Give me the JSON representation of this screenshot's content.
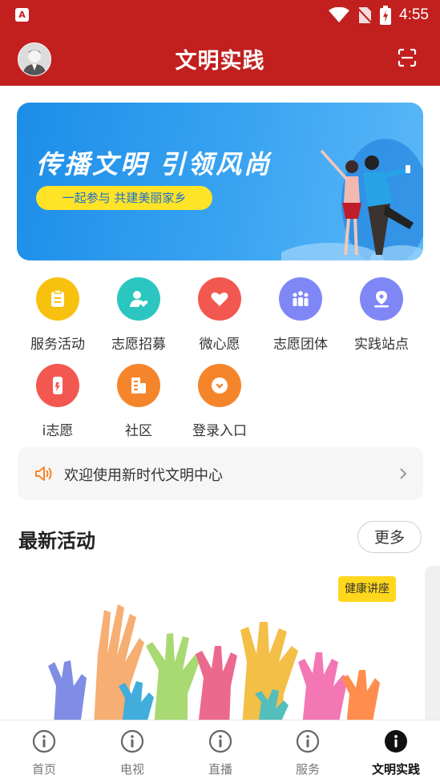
{
  "status_bar": {
    "time": "4:55",
    "app_icon": "A"
  },
  "header": {
    "title": "文明实践"
  },
  "banner": {
    "title": "传播文明 引领风尚",
    "subtitle": "一起参与 共建美丽家乡"
  },
  "grid": [
    {
      "label": "服务活动",
      "color": "#f8c10e",
      "icon": "clipboard-icon"
    },
    {
      "label": "志愿招募",
      "color": "#2cc6c0",
      "icon": "user-heart-icon"
    },
    {
      "label": "微心愿",
      "color": "#f2584f",
      "icon": "heart-icon"
    },
    {
      "label": "志愿团体",
      "color": "#7f87f6",
      "icon": "group-icon"
    },
    {
      "label": "实践站点",
      "color": "#7f87f6",
      "icon": "location-icon"
    },
    {
      "label": "i志愿",
      "color": "#f2584f",
      "icon": "phone-icon"
    },
    {
      "label": "社区",
      "color": "#f5852b",
      "icon": "building-icon"
    },
    {
      "label": "登录入口",
      "color": "#f5852b",
      "icon": "login-icon"
    }
  ],
  "notice": {
    "text": "欢迎使用新时代文明中心"
  },
  "latest": {
    "title": "最新活动",
    "more_label": "更多",
    "card_tag": "健康讲座"
  },
  "nav": [
    {
      "label": "首页",
      "active": false
    },
    {
      "label": "电视",
      "active": false
    },
    {
      "label": "直播",
      "active": false
    },
    {
      "label": "服务",
      "active": false
    },
    {
      "label": "文明实践",
      "active": true
    }
  ],
  "colors": {
    "header": "#c21f1f",
    "banner": "#2a98ee",
    "pill": "#ffe327",
    "tag": "#ffd71c"
  }
}
